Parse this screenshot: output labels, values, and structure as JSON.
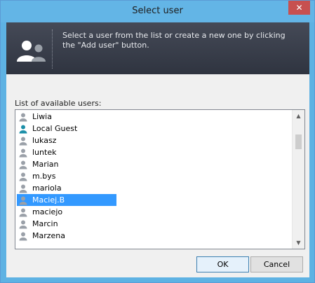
{
  "window": {
    "title": "Select user"
  },
  "titlebar": {
    "close_icon": "close-icon"
  },
  "banner": {
    "icon": "users-icon",
    "text": "Select a user from the list or create a new one by clicking the \"Add user\" button."
  },
  "list": {
    "label": "List of available users:",
    "items": [
      {
        "label": "Liwia",
        "icon": "user-gray-icon",
        "selected": false
      },
      {
        "label": "Local Guest",
        "icon": "user-teal-icon",
        "selected": false
      },
      {
        "label": "lukasz",
        "icon": "user-gray-icon",
        "selected": false
      },
      {
        "label": "luntek",
        "icon": "user-gray-icon",
        "selected": false
      },
      {
        "label": "Marian",
        "icon": "user-gray-icon",
        "selected": false
      },
      {
        "label": "m.bys",
        "icon": "user-gray-icon",
        "selected": false
      },
      {
        "label": "mariola",
        "icon": "user-gray-icon",
        "selected": false
      },
      {
        "label": "Maciej.B",
        "icon": "user-gray-icon",
        "selected": true
      },
      {
        "label": "maciejo",
        "icon": "user-gray-icon",
        "selected": false
      },
      {
        "label": "Marcin",
        "icon": "user-gray-icon",
        "selected": false
      },
      {
        "label": "Marzena",
        "icon": "user-gray-icon",
        "selected": false
      }
    ]
  },
  "buttons": {
    "ok": "OK",
    "cancel": "Cancel"
  },
  "colors": {
    "titlebar": "#63b5e6",
    "close": "#c75050",
    "banner": "#3b404c",
    "selection": "#3399ff",
    "user_gray": "#9aa0a8",
    "user_teal": "#1b8fa8"
  }
}
